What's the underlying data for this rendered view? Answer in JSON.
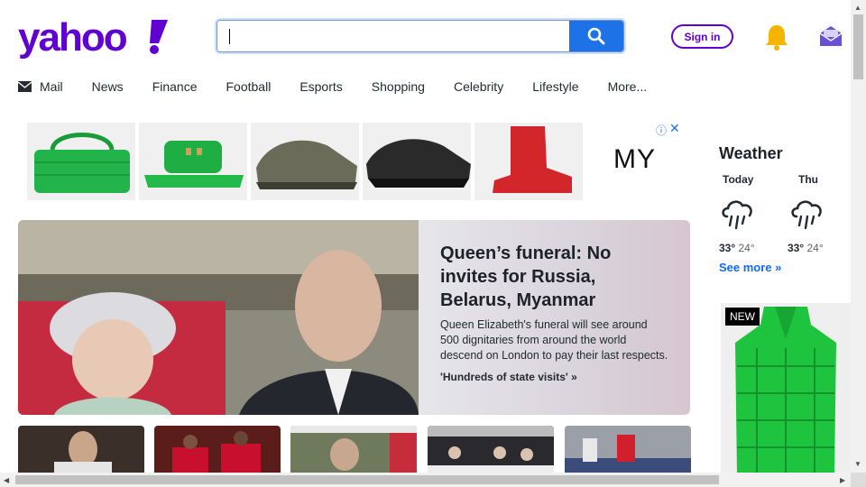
{
  "header": {
    "logo_text": "yahoo!",
    "search": {
      "value": "",
      "placeholder": ""
    },
    "signin_label": "Sign in",
    "icons": [
      "search-icon",
      "bell-icon",
      "mail-icon"
    ]
  },
  "nav": {
    "items": [
      {
        "label": "Mail",
        "icon": "mail-icon"
      },
      {
        "label": "News"
      },
      {
        "label": "Finance"
      },
      {
        "label": "Football"
      },
      {
        "label": "Esports"
      },
      {
        "label": "Shopping"
      },
      {
        "label": "Celebrity"
      },
      {
        "label": "Lifestyle"
      },
      {
        "label": "More..."
      }
    ]
  },
  "ad_banner": {
    "brand": "MY",
    "info_icon": "ⓘ",
    "close_icon": "✕"
  },
  "hero": {
    "title": "Queen’s funeral: No invites for Russia, Belarus, Myanmar",
    "body": "Queen Elizabeth's funeral will see around 500 dignitaries from around the world descend on London to pay their last respects.",
    "link": "'Hundreds of state visits' »"
  },
  "weather": {
    "title": "Weather",
    "days": [
      {
        "label": "Today",
        "high": "33°",
        "low": "24°",
        "icon": "rain-cloud-icon"
      },
      {
        "label": "Thu",
        "high": "33°",
        "low": "24°",
        "icon": "rain-cloud-icon"
      }
    ],
    "see_more": "See more »"
  },
  "side_ad": {
    "badge": "NEW"
  },
  "colors": {
    "brand_purple": "#6001d2",
    "search_blue": "#1d72e8",
    "link_blue": "#0f69ff"
  }
}
